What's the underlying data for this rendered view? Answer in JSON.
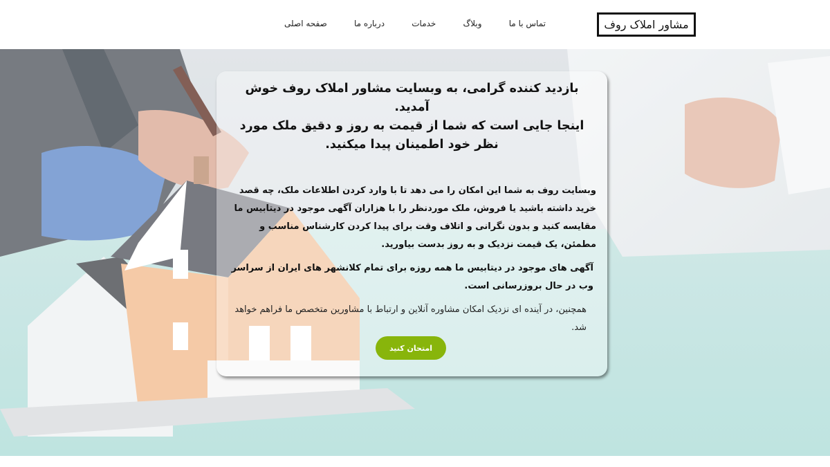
{
  "header": {
    "logo_text": "مشاور املاک روف",
    "nav": [
      {
        "label": "صفحه اصلی"
      },
      {
        "label": "درباره ما"
      },
      {
        "label": "خدمات"
      },
      {
        "label": "وبلاگ"
      },
      {
        "label": "تماس با ما"
      }
    ]
  },
  "hero": {
    "headline_line1": "بازدید کننده گرامی، به وبسایت مشاور املاک روف خوش آمدید.",
    "headline_line2": "اینجا جایی است که شما از قیمت به روز و دقیق ملک مورد نظر خود اطمینان پیدا میکنید.",
    "paragraph1": "وبسایت روف به شما این امکان را می دهد تا با وارد کردن اطلاعات ملک، چه قصد خرید داشته باشید یا فروش، ملک موردنظر را با هزاران آگهی موجود در دیتابیس ما مقایسه کنید و بدون نگرانی و اتلاف وقت برای پیدا کردن کارشناس مناسب و مطمئن، یک قیمت نزدیک و به روز بدست بیاورید.",
    "paragraph2": "آگهی های موجود در دیتابیس ما همه روزه برای تمام کلانشهر های ایران از سراسر وب در حال بروزرسانی است.",
    "paragraph3": "همچنین، در آینده ای نزدیک امکان مشاوره آنلاین و ارتباط با مشاورین متخصص ما فراهم خواهد شد.",
    "cta_label": "امتحان کنید"
  },
  "colors": {
    "accent": "#88b50b",
    "logo_border": "#111111"
  }
}
